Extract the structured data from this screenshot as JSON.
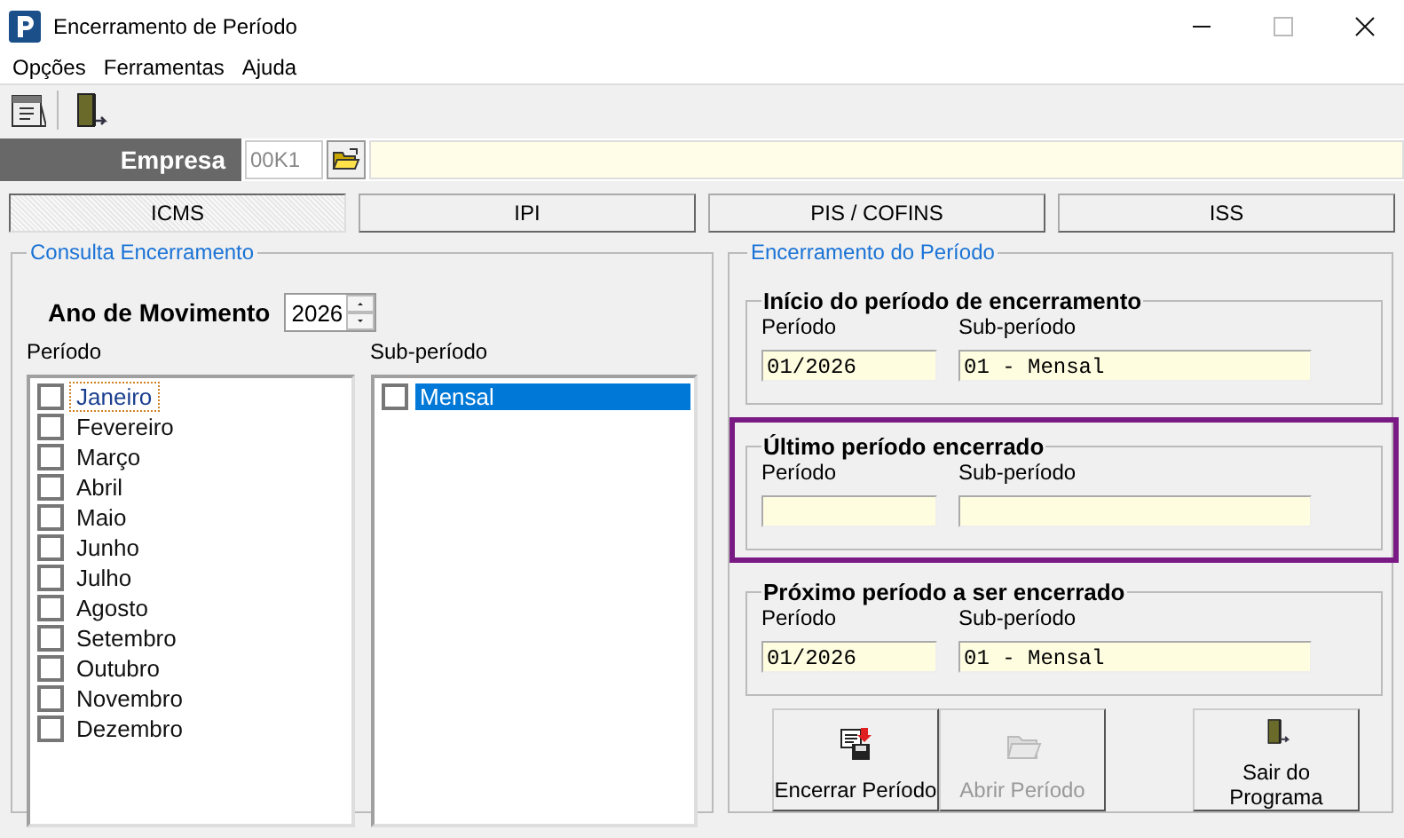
{
  "window": {
    "title": "Encerramento de Período"
  },
  "menu": [
    {
      "label": "Opções"
    },
    {
      "label": "Ferramentas"
    },
    {
      "label": "Ajuda"
    }
  ],
  "toolbar": [
    {
      "kind": "calendar"
    },
    {
      "kind": "exit"
    }
  ],
  "company": {
    "label": "Empresa",
    "code": "00K1"
  },
  "tabs": [
    {
      "label": "ICMS",
      "selected": true
    },
    {
      "label": "IPI",
      "selected": false
    },
    {
      "label": "PIS / COFINS",
      "selected": false
    },
    {
      "label": "ISS",
      "selected": false
    }
  ],
  "query": {
    "title": "Consulta Encerramento",
    "year_label": "Ano de Movimento",
    "year": "2026",
    "period_label": "Período",
    "subperiod_label": "Sub-período",
    "periods": [
      {
        "label": "Janeiro",
        "checked": false,
        "focused": true
      },
      {
        "label": "Fevereiro",
        "checked": false,
        "focused": false
      },
      {
        "label": "Março",
        "checked": false,
        "focused": false
      },
      {
        "label": "Abril",
        "checked": false,
        "focused": false
      },
      {
        "label": "Maio",
        "checked": false,
        "focused": false
      },
      {
        "label": "Junho",
        "checked": false,
        "focused": false
      },
      {
        "label": "Julho",
        "checked": false,
        "focused": false
      },
      {
        "label": "Agosto",
        "checked": false,
        "focused": false
      },
      {
        "label": "Setembro",
        "checked": false,
        "focused": false
      },
      {
        "label": "Outubro",
        "checked": false,
        "focused": false
      },
      {
        "label": "Novembro",
        "checked": false,
        "focused": false
      },
      {
        "label": "Dezembro",
        "checked": false,
        "focused": false
      }
    ],
    "subperiods": [
      {
        "label": "Mensal",
        "checked": false,
        "selected": true
      }
    ]
  },
  "closing": {
    "title": "Encerramento do Período",
    "groups": [
      {
        "title": "Início do período de encerramento",
        "highlighted": false,
        "period_label": "Período",
        "period": "01/2026",
        "subperiod_label": "Sub-período",
        "subperiod": "01 - Mensal"
      },
      {
        "title": "Último período encerrado",
        "highlighted": true,
        "period_label": "Período",
        "subperiod_label": "Sub-período"
      },
      {
        "title": "Próximo período a ser encerrado",
        "highlighted": false,
        "period_label": "Período",
        "period": "01/2026",
        "subperiod_label": "Sub-período",
        "subperiod": "01 - Mensal"
      }
    ]
  },
  "buttons": [
    {
      "label": "Encerrar Período",
      "kind": "close",
      "disabled": false
    },
    {
      "label": "Abrir Período",
      "kind": "open",
      "disabled": true
    },
    {
      "label": "Sair do Programa",
      "kind": "exit",
      "disabled": false
    }
  ]
}
